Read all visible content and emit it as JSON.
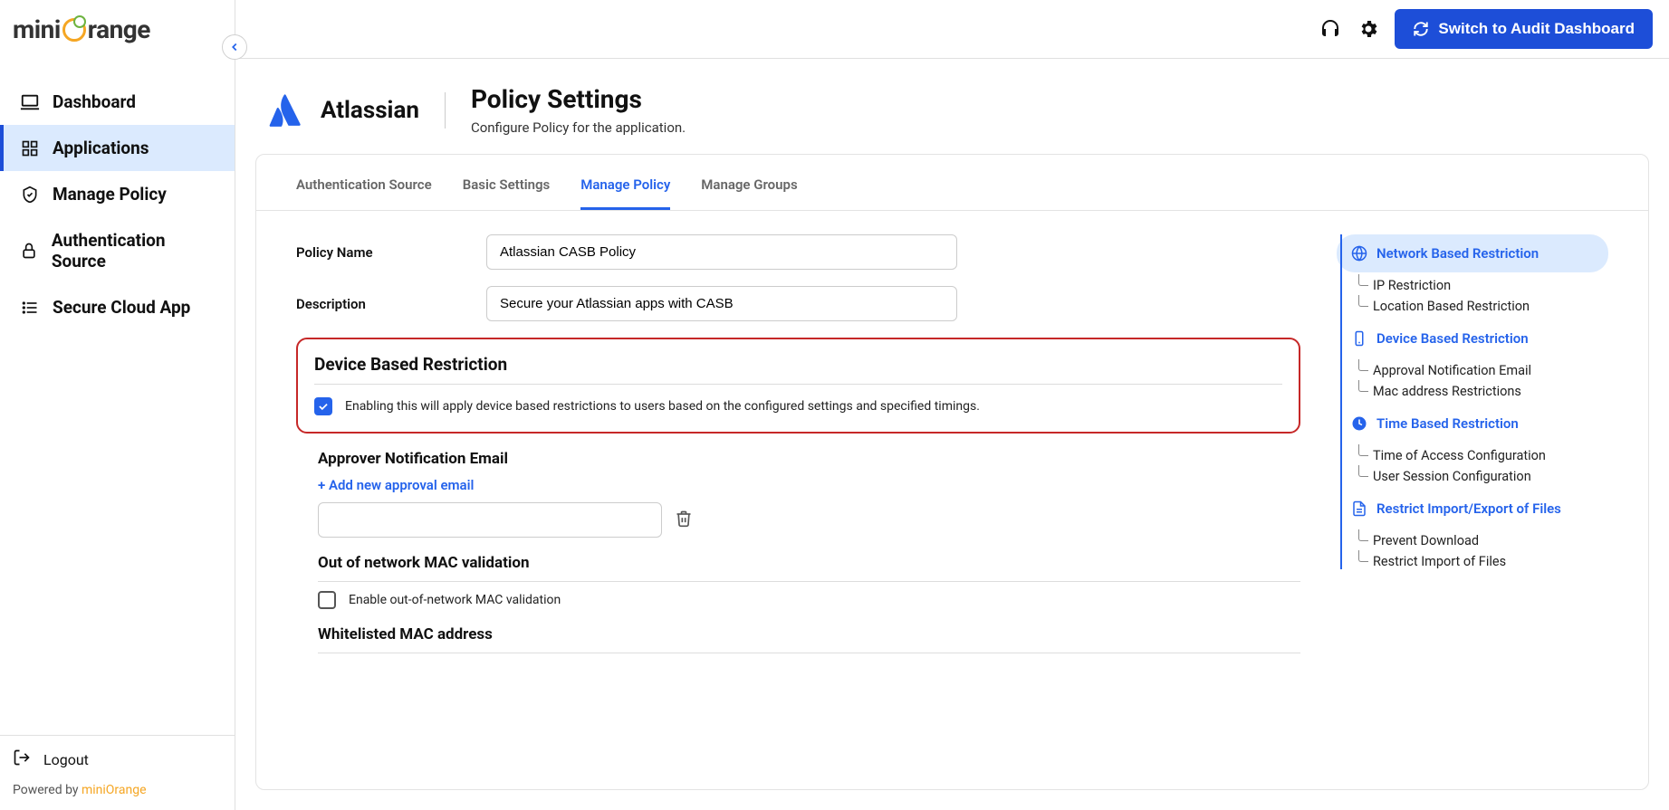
{
  "brand": "miniOrange",
  "sidebar": {
    "items": [
      {
        "label": "Dashboard"
      },
      {
        "label": "Applications"
      },
      {
        "label": "Manage Policy"
      },
      {
        "label": "Authentication Source"
      },
      {
        "label": "Secure Cloud App"
      }
    ],
    "logout": "Logout",
    "powered_prefix": "Powered by ",
    "powered_link": "miniOrange"
  },
  "topbar": {
    "switch_label": "Switch to Audit Dashboard"
  },
  "header": {
    "app_name": "Atlassian",
    "title": "Policy Settings",
    "subtitle": "Configure Policy for the application."
  },
  "tabs": [
    {
      "label": "Authentication Source"
    },
    {
      "label": "Basic Settings"
    },
    {
      "label": "Manage Policy"
    },
    {
      "label": "Manage Groups"
    }
  ],
  "form": {
    "policy_name_label": "Policy Name",
    "policy_name_value": "Atlassian CASB Policy",
    "description_label": "Description",
    "description_value": "Secure your Atlassian apps with CASB",
    "device_section_title": "Device Based Restriction",
    "device_enable_text": "Enabling this will apply device based restrictions to users based on the configured settings and specified timings.",
    "approver_title": "Approver Notification Email",
    "add_email_label": "+ Add new approval email",
    "mac_title": "Out of network MAC validation",
    "mac_check_label": "Enable out-of-network MAC validation",
    "whitelist_title": "Whitelisted MAC address"
  },
  "rightnav": {
    "network": "Network Based Restriction",
    "network_subs": [
      "IP Restriction",
      "Location Based Restriction"
    ],
    "device": "Device Based Restriction",
    "device_subs": [
      "Approval Notification Email",
      "Mac address Restrictions"
    ],
    "time": "Time Based Restriction",
    "time_subs": [
      "Time of Access Configuration",
      "User Session Configuration"
    ],
    "restrict": "Restrict Import/Export of Files",
    "restrict_subs": [
      "Prevent Download",
      "Restrict Import of Files"
    ]
  }
}
